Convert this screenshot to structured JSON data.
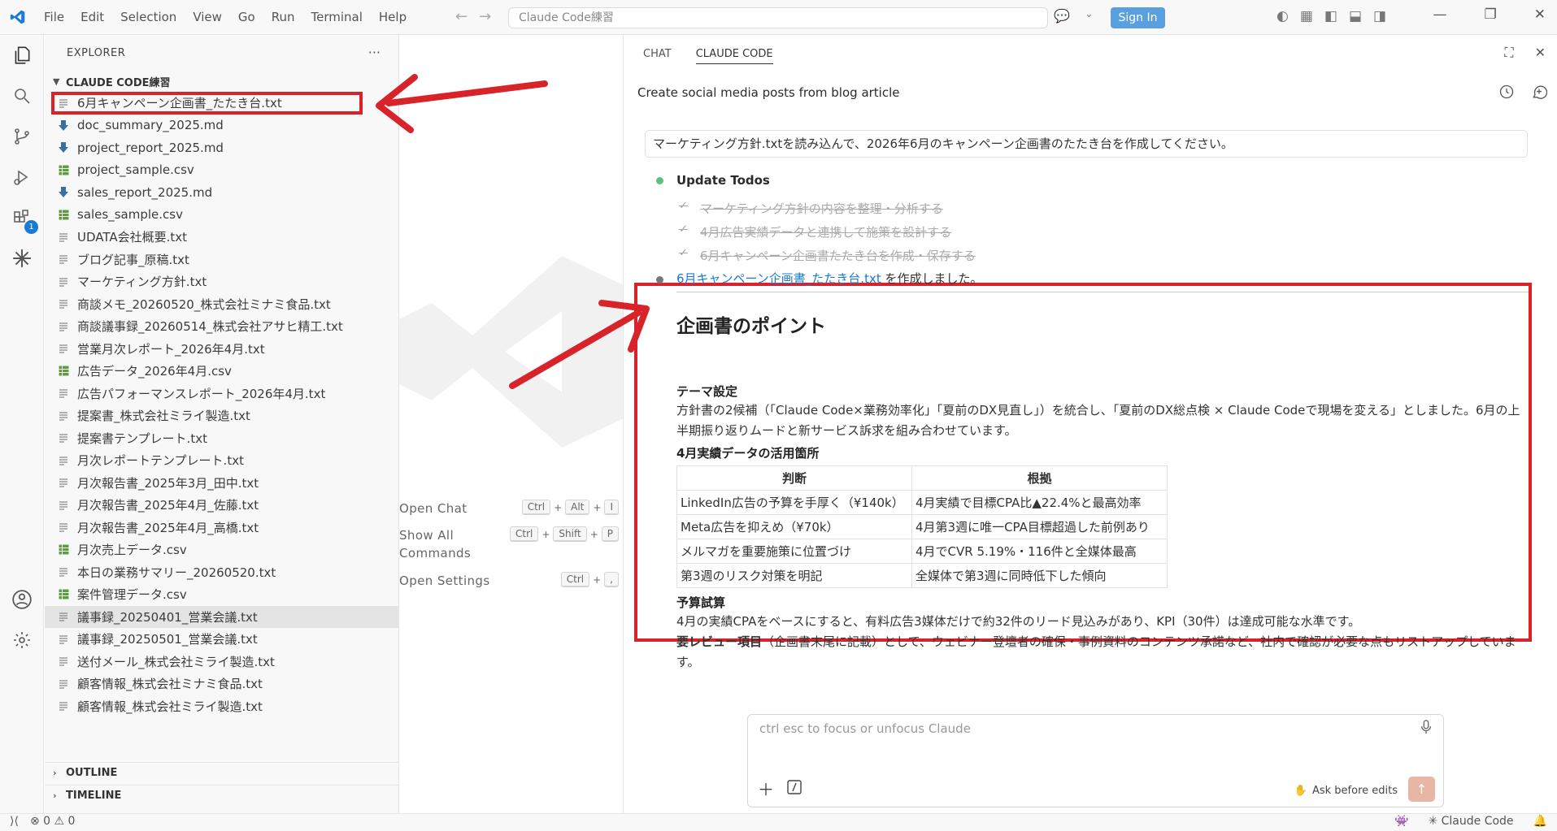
{
  "titlebar": {
    "menu": [
      "File",
      "Edit",
      "Selection",
      "View",
      "Go",
      "Run",
      "Terminal",
      "Help"
    ],
    "search_placeholder": "Claude Code練習",
    "signin_label": "Sign In"
  },
  "sidebar": {
    "title": "EXPLORER",
    "more": "···",
    "folder": "CLAUDE CODE練習",
    "files": [
      {
        "name": "6月キャンペーン企画書_たたき台.txt",
        "type": "txt"
      },
      {
        "name": "doc_summary_2025.md",
        "type": "md"
      },
      {
        "name": "project_report_2025.md",
        "type": "md"
      },
      {
        "name": "project_sample.csv",
        "type": "csv"
      },
      {
        "name": "sales_report_2025.md",
        "type": "md"
      },
      {
        "name": "sales_sample.csv",
        "type": "csv"
      },
      {
        "name": "UDATA会社概要.txt",
        "type": "txt"
      },
      {
        "name": "ブログ記事_原稿.txt",
        "type": "txt"
      },
      {
        "name": "マーケティング方針.txt",
        "type": "txt"
      },
      {
        "name": "商談メモ_20260520_株式会社ミナミ食品.txt",
        "type": "txt"
      },
      {
        "name": "商談議事録_20260514_株式会社アサヒ精工.txt",
        "type": "txt"
      },
      {
        "name": "営業月次レポート_2026年4月.txt",
        "type": "txt"
      },
      {
        "name": "広告データ_2026年4月.csv",
        "type": "csv"
      },
      {
        "name": "広告パフォーマンスレポート_2026年4月.txt",
        "type": "txt"
      },
      {
        "name": "提案書_株式会社ミライ製造.txt",
        "type": "txt"
      },
      {
        "name": "提案書テンプレート.txt",
        "type": "txt"
      },
      {
        "name": "月次レポートテンプレート.txt",
        "type": "txt"
      },
      {
        "name": "月次報告書_2025年3月_田中.txt",
        "type": "txt"
      },
      {
        "name": "月次報告書_2025年4月_佐藤.txt",
        "type": "txt"
      },
      {
        "name": "月次報告書_2025年4月_高橋.txt",
        "type": "txt"
      },
      {
        "name": "月次売上データ.csv",
        "type": "csv"
      },
      {
        "name": "本日の業務サマリー_20260520.txt",
        "type": "txt"
      },
      {
        "name": "案件管理データ.csv",
        "type": "csv"
      },
      {
        "name": "議事録_20250401_営業会議.txt",
        "type": "txt"
      },
      {
        "name": "議事録_20250501_営業会議.txt",
        "type": "txt"
      },
      {
        "name": "送付メール_株式会社ミライ製造.txt",
        "type": "txt"
      },
      {
        "name": "顧客情報_株式会社ミナミ食品.txt",
        "type": "txt"
      },
      {
        "name": "顧客情報_株式会社ミライ製造.txt",
        "type": "txt"
      }
    ],
    "outline": "OUTLINE",
    "timeline": "TIMELINE"
  },
  "activity": {
    "extensions_badge": "1"
  },
  "editor": {
    "shortcuts": [
      {
        "label": "Open Chat",
        "keys": [
          "Ctrl",
          "Alt",
          "I"
        ]
      },
      {
        "label": "Show All Commands",
        "keys": [
          "Ctrl",
          "Shift",
          "P"
        ]
      },
      {
        "label": "Open Settings",
        "keys": [
          "Ctrl",
          ","
        ]
      }
    ]
  },
  "panel": {
    "tabs": [
      "CHAT",
      "CLAUDE CODE"
    ],
    "session_title": "Create social media posts from blog article",
    "user_message": "マーケティング方針.txtを読み込んで、2026年6月のキャンペーン企画書のたたき台を作成してください。",
    "todo_title": "Update Todos",
    "todos": [
      "マーケティング方針の内容を整理・分析する",
      "4月広告実績データと連携して施策を設計する",
      "6月キャンペーン企画書たたき台を作成・保存する"
    ],
    "result_link": "6月キャンペーン企画書_たたき台.txt",
    "result_suffix": " を作成しました。",
    "heading": "企画書のポイント",
    "theme_title": "テーマ設定",
    "theme_text": "方針書の2候補（「Claude Code×業務効率化」「夏前のDX見直し」）を統合し、「夏前のDX総点検 × Claude Codeで現場を変える」としました。6月の上半期振り返りムードと新サービス訴求を組み合わせています。",
    "data_title": "4月実績データの活用箇所",
    "table": {
      "headers": [
        "判断",
        "根拠"
      ],
      "rows": [
        [
          "LinkedIn広告の予算を手厚く（¥140k）",
          "4月実績で目標CPA比▲22.4%と最高効率"
        ],
        [
          "Meta広告を抑えめ（¥70k）",
          "4月第3週に唯一CPA目標超過した前例あり"
        ],
        [
          "メルマガを重要施策に位置づけ",
          "4月でCVR 5.19%・116件と全媒体最高"
        ],
        [
          "第3週のリスク対策を明記",
          "全媒体で第3週に同時低下した傾向"
        ]
      ]
    },
    "budget_title": "予算試算",
    "budget_text": "4月の実績CPAをベースにすると、有料広告3媒体だけで約32件のリード見込みがあり、KPI（30件）は達成可能な水準です。",
    "review_title": "要レビュー項目",
    "review_text": "（企画書末尾に記載）として、ウェビナー登壇者の確保・事例資料のコンテンツ承諾など、社内で確認が必要な点もリストアップしています。",
    "input_placeholder": "ctrl esc to focus or unfocus Claude",
    "ask_label": "Ask before edits"
  },
  "statusbar": {
    "errors": "0",
    "warnings": "0",
    "claude": "Claude Code"
  },
  "colors": {
    "accent": "#1a7ad4",
    "annotation_red": "#d9232a",
    "csv_green": "#5aa13c",
    "md_blue": "#3a6fa0"
  }
}
